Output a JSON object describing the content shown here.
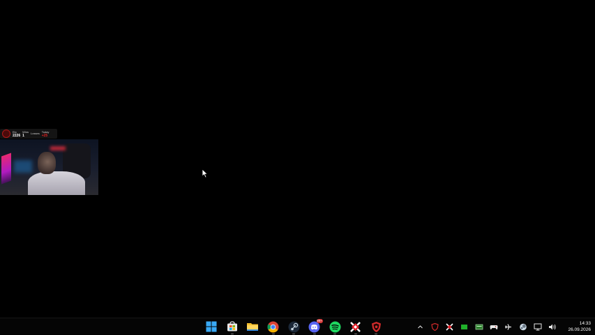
{
  "stats_overlay": {
    "elo_label": "Elo",
    "elo_value": "2226",
    "wins_label": "Wins",
    "wins_value": "1",
    "losses_label": "Losses",
    "losses_value": "",
    "today_label": "Today",
    "today_value": "+25",
    "accent_color": "#e02020"
  },
  "taskbar": {
    "pinned": [
      {
        "name": "start-icon"
      },
      {
        "name": "microsoft-store-icon"
      },
      {
        "name": "file-explorer-icon"
      },
      {
        "name": "chrome-icon"
      },
      {
        "name": "steam-icon"
      },
      {
        "name": "discord-icon",
        "badge": "99+"
      },
      {
        "name": "spotify-icon"
      },
      {
        "name": "faceit-icon"
      },
      {
        "name": "antivirus-shield-icon"
      }
    ],
    "tray": [
      {
        "name": "show-hidden-icons-chevron-icon"
      },
      {
        "name": "shield-tray-icon"
      },
      {
        "name": "faceit-tray-icon"
      },
      {
        "name": "nvidia-tray-icon"
      },
      {
        "name": "battery-monitor-tray-icon"
      },
      {
        "name": "gamepad-tray-icon"
      },
      {
        "name": "plane-tray-icon"
      },
      {
        "name": "steam-tray-icon"
      },
      {
        "name": "network-icon"
      },
      {
        "name": "volume-icon"
      }
    ],
    "clock": {
      "time": "14:33",
      "date": "26.09.2026"
    }
  }
}
